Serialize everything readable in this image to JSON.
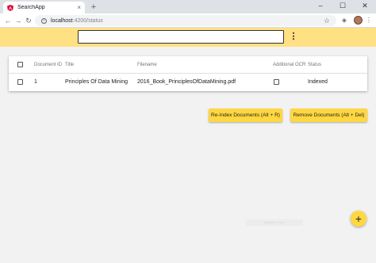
{
  "browser": {
    "tab_title": "SearchApp",
    "tab_close": "×",
    "new_tab": "+",
    "win_minimize": "–",
    "win_maximize": "☐",
    "win_close": "✕",
    "url_host": "localhost",
    "url_path": ":4200/status"
  },
  "app": {
    "search": {
      "value": "",
      "placeholder": ""
    },
    "menu_icon": "⋮",
    "table": {
      "headers": [
        "Document ID",
        "Title",
        "Filename",
        "Additional OCR",
        "Status"
      ],
      "rows": [
        {
          "document_id": "1",
          "title": "Principles Of Data Mining",
          "filename": "2016_Book_PrinciplesOfDataMining.pdf",
          "additional_ocr": false,
          "status": "Indexed"
        }
      ]
    },
    "reindex_label": "Re-Index Documents (Alt + R)",
    "remove_label": "Remove Documents (Alt + Del)",
    "snackbar_text": "Indexed 1 item",
    "fab_label": "+",
    "accent_color": "#ffd740",
    "toolbar_color": "#ffe082"
  }
}
